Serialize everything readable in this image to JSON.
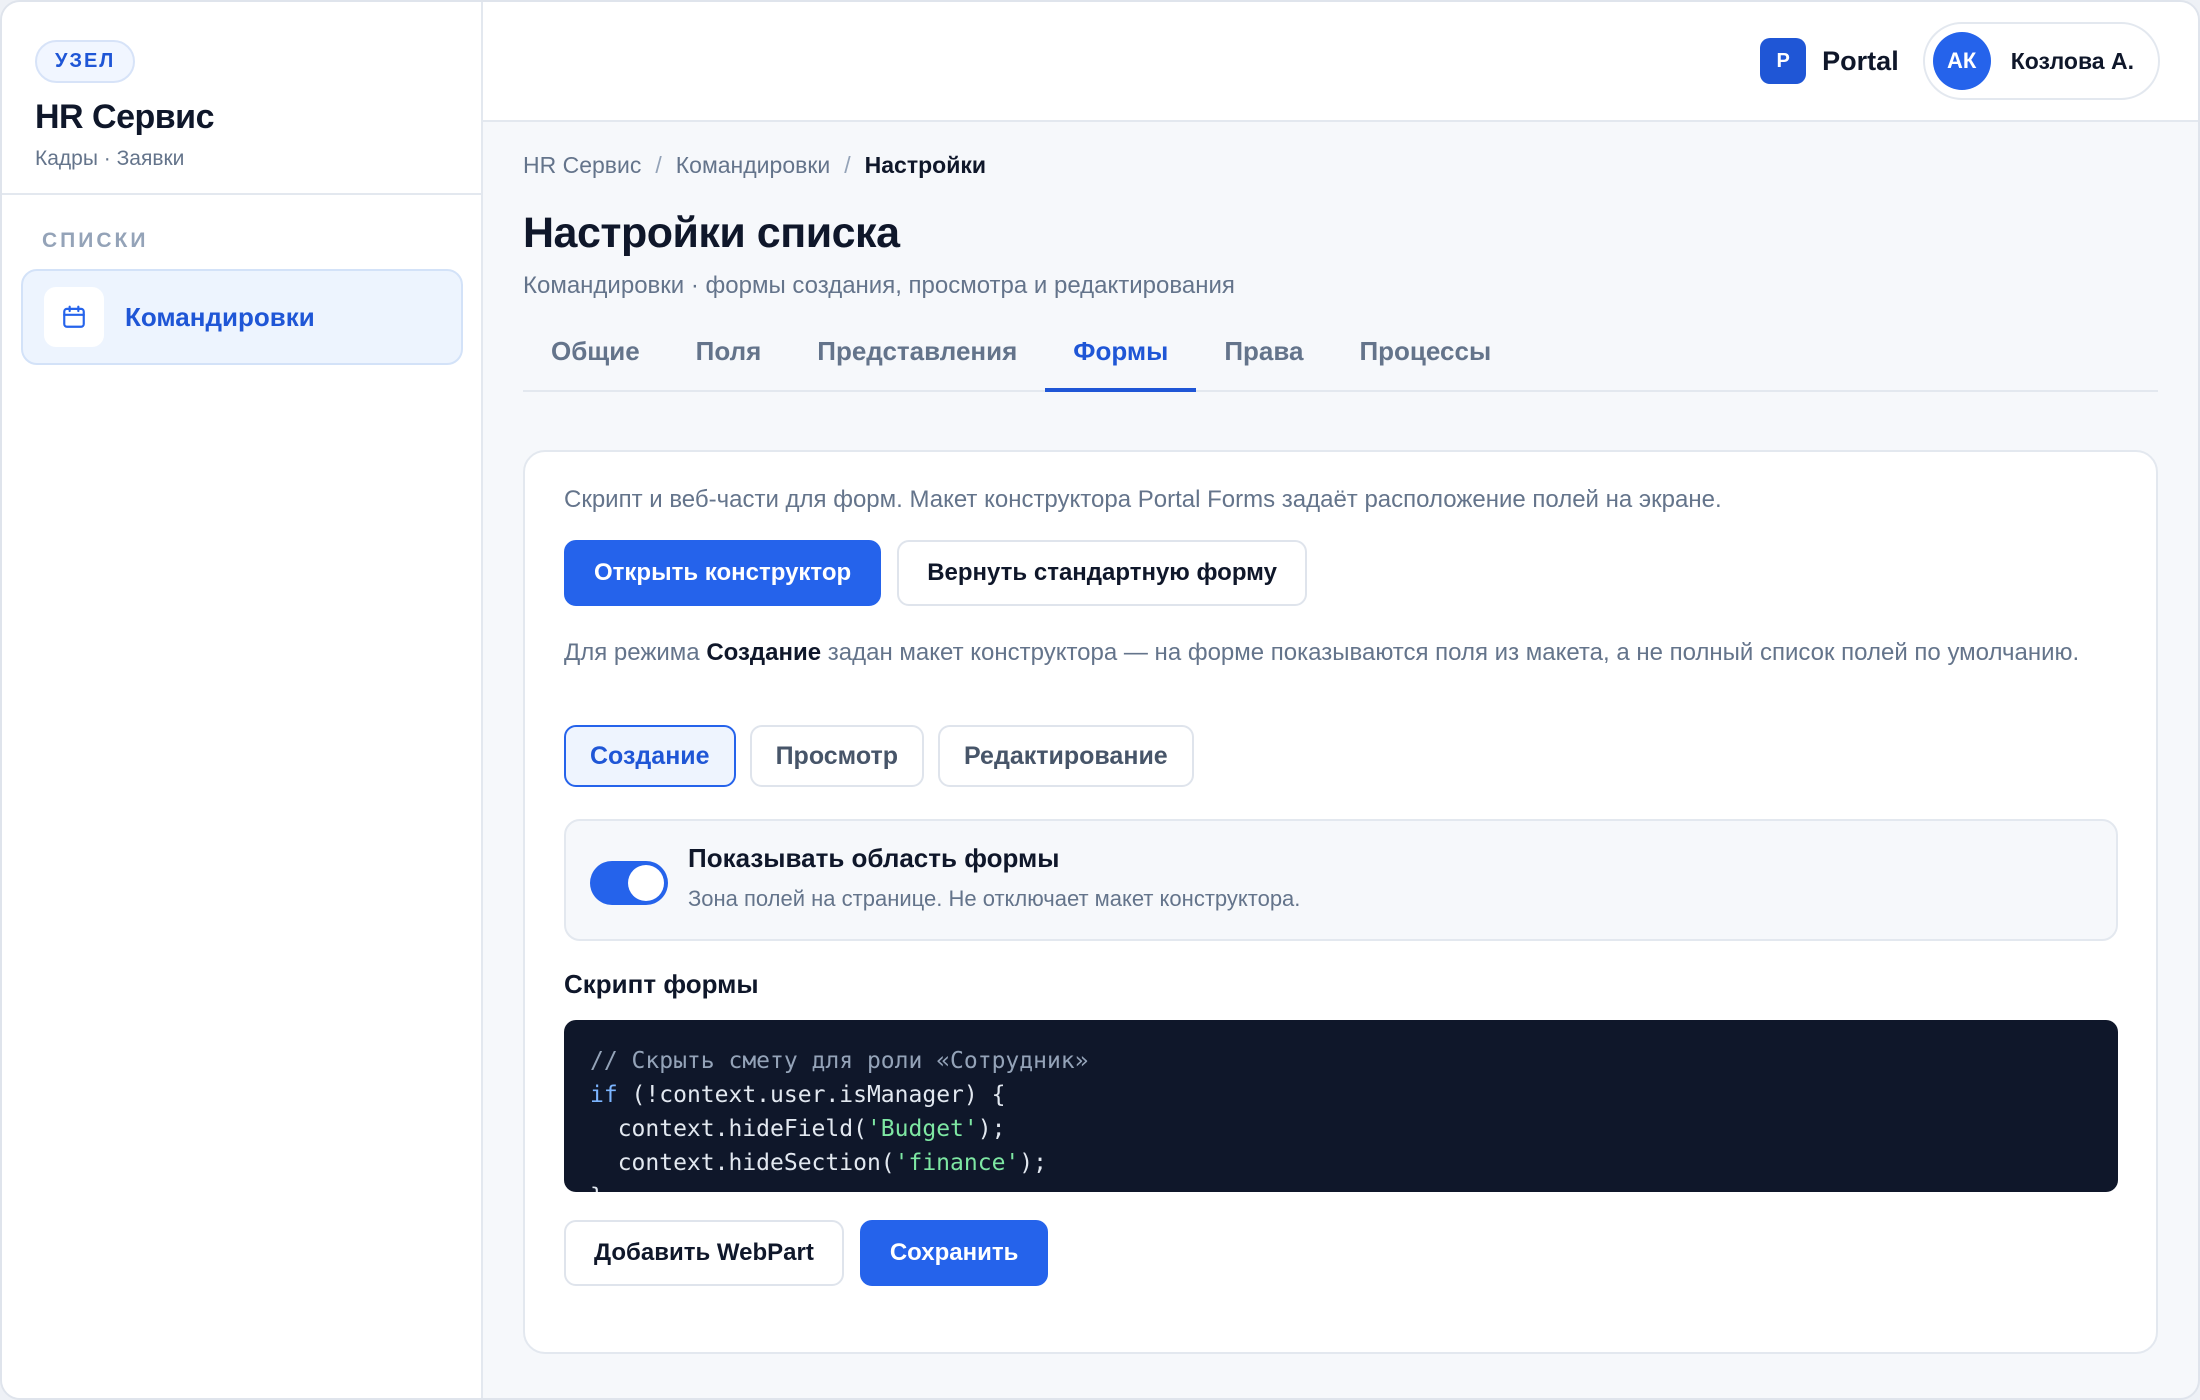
{
  "sidebar": {
    "badge": "УЗЕЛ",
    "title": "HR Сервис",
    "subtitle": "Кадры · Заявки",
    "section_label": "СПИСКИ",
    "items": [
      {
        "label": "Командировки",
        "icon": "calendar-icon",
        "active": true
      }
    ]
  },
  "topbar": {
    "brand_logo": "P",
    "brand_name": "Portal",
    "user_initials": "АК",
    "user_name": "Козлова А."
  },
  "breadcrumb": [
    "HR Сервис",
    "Командировки",
    "Настройки"
  ],
  "breadcrumb_sep": "/",
  "page": {
    "title": "Настройки списка",
    "subtitle": "Командировки · формы создания, просмотра и редактирования"
  },
  "tabs": [
    {
      "label": "Общие",
      "active": false
    },
    {
      "label": "Поля",
      "active": false
    },
    {
      "label": "Представления",
      "active": false
    },
    {
      "label": "Формы",
      "active": true
    },
    {
      "label": "Права",
      "active": false
    },
    {
      "label": "Процессы",
      "active": false
    }
  ],
  "forms_card": {
    "description": "Скрипт и веб-части для форм. Макет конструктора Portal Forms задаёт расположение полей на экране.",
    "open_builder_label": "Открыть конструктор",
    "reset_form_label": "Вернуть стандартную форму",
    "note_prefix": "Для режима ",
    "note_mode": "Создание",
    "note_suffix": " задан макет конструктора — на форме показываются поля из макета, а не полный список полей по умолчанию.",
    "modes": [
      {
        "label": "Создание",
        "active": true
      },
      {
        "label": "Просмотр",
        "active": false
      },
      {
        "label": "Редактирование",
        "active": false
      }
    ],
    "toggle": {
      "title": "Показывать область формы",
      "subtitle": "Зона полей на странице. Не отключает макет конструктора.",
      "on": true
    },
    "script_label": "Скрипт формы",
    "code": {
      "comment": "// Скрыть смету для роли «Сотрудник»",
      "line2_kw": "if",
      "line2_rest": " (!context.user.isManager) {",
      "line3_pre": "  context.hideField(",
      "line3_str": "'Budget'",
      "line3_post": ");",
      "line4_pre": "  context.hideSection(",
      "line4_str": "'finance'",
      "line4_post": ");",
      "line5": "}"
    },
    "add_webpart_label": "Добавить WebPart",
    "save_label": "Сохранить"
  },
  "colors": {
    "accent": "#2563eb",
    "accent_text": "#1f56d6",
    "code_bg": "#0f172a"
  }
}
